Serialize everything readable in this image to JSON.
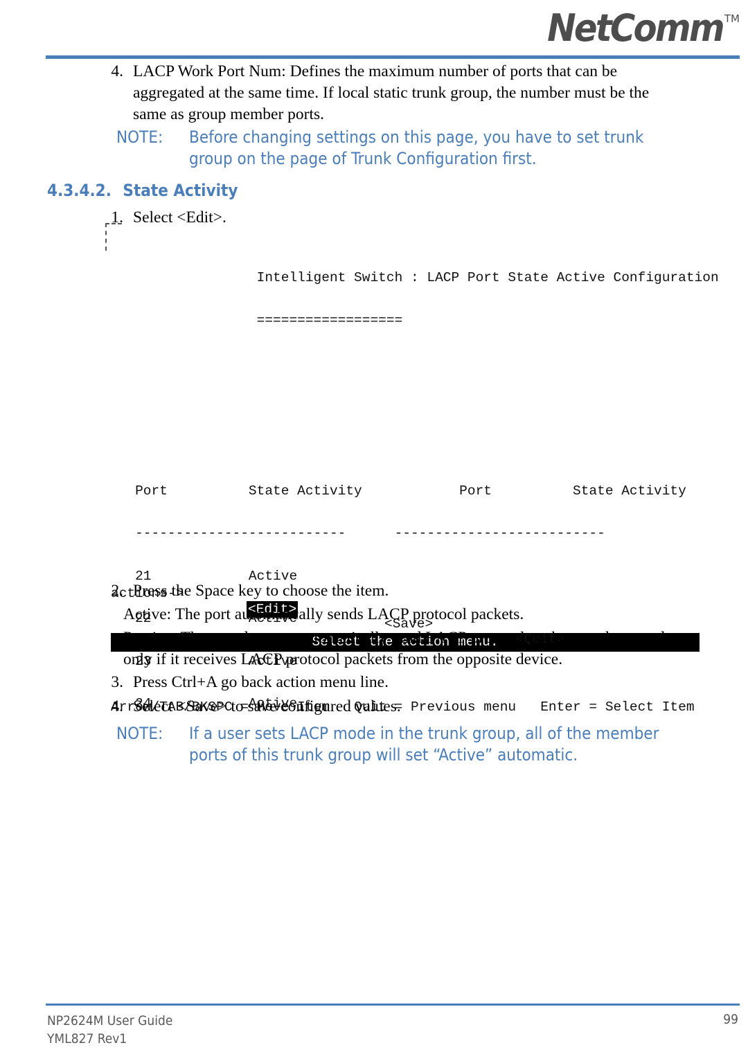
{
  "header": {
    "logo_text": "NetComm",
    "logo_tm": "TM",
    "rule_color": "#4a7ebb"
  },
  "intro": {
    "number": "4.",
    "text": "LACP Work Port Num: Defines the maximum number of ports that can be aggregated at the same time.  If local static trunk group, the number must be the same as group member ports."
  },
  "note_top": {
    "label": "NOTE:",
    "text": "Before changing settings on this page, you have to set trunk group on the page of Trunk Configuration first."
  },
  "section": {
    "number": "4.3.4.2.",
    "title": "State Activity"
  },
  "steps": {
    "step1": {
      "number": "1.",
      "text": "Select <Edit>."
    },
    "step2": {
      "number": "2.",
      "text": "Press the Space key to choose the item."
    },
    "step2_active": "Active: The port automatically sends LACP protocol packets.",
    "step2_passive": "Passive: The port does not automatically send LACP protocol packets, and responds only if it receives LACP protocol packets from the opposite device.",
    "step3": {
      "number": "3.",
      "text": "Press Ctrl+A go back action menu line."
    },
    "step4": {
      "number": "4.",
      "text": "Select <Save> to save configured values."
    }
  },
  "terminal": {
    "title": "                  Intelligent Switch : LACP Port State Active Configuration",
    "title_rule": "                  ==================",
    "col_headers": "   Port          State Activity            Port          State Activity",
    "col_rule": "   --------------------------      --------------------------",
    "rows": [
      "   21            Active",
      "   22            Active",
      "   23            Active",
      "   24            Active"
    ],
    "actions_label": "actions->",
    "actions": [
      {
        "label": "<Edit>",
        "selected": true
      },
      {
        "label": "<Save>",
        "selected": false
      },
      {
        "label": "<Quit>",
        "selected": false
      }
    ],
    "status_text": "Select the action menu.",
    "help_line": "Arrow/TAB/BKSPC = Move Item   Quit = Previous menu   Enter = Select Item"
  },
  "note_bottom": {
    "label": "NOTE:",
    "text": "If a user sets LACP mode in the trunk group, all of the member ports of this trunk group will set “Active” automatic."
  },
  "footer": {
    "line1": "NP2624M User Guide",
    "line2": "YML827 Rev1",
    "page_number": "99"
  }
}
